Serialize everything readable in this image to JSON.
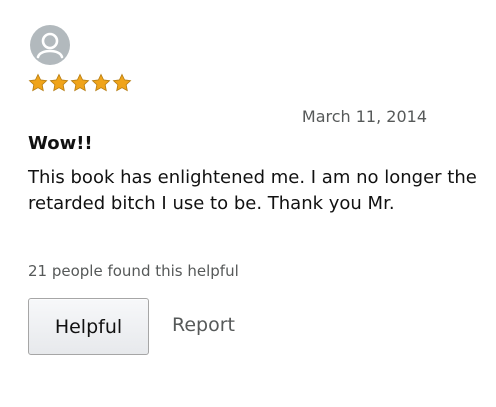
{
  "review": {
    "avatar_icon": "user-silhouette-icon",
    "rating": 5,
    "rating_max": 5,
    "star_color": "#f0a41a",
    "date": "March 11, 2014",
    "title": "Wow!!",
    "body": "This book has enlightened me. I am no longer the retarded bitch I use to be. Thank you Mr.",
    "helpful_count": "21 people found this helpful"
  },
  "actions": {
    "helpful_label": "Helpful",
    "report_label": "Report"
  }
}
